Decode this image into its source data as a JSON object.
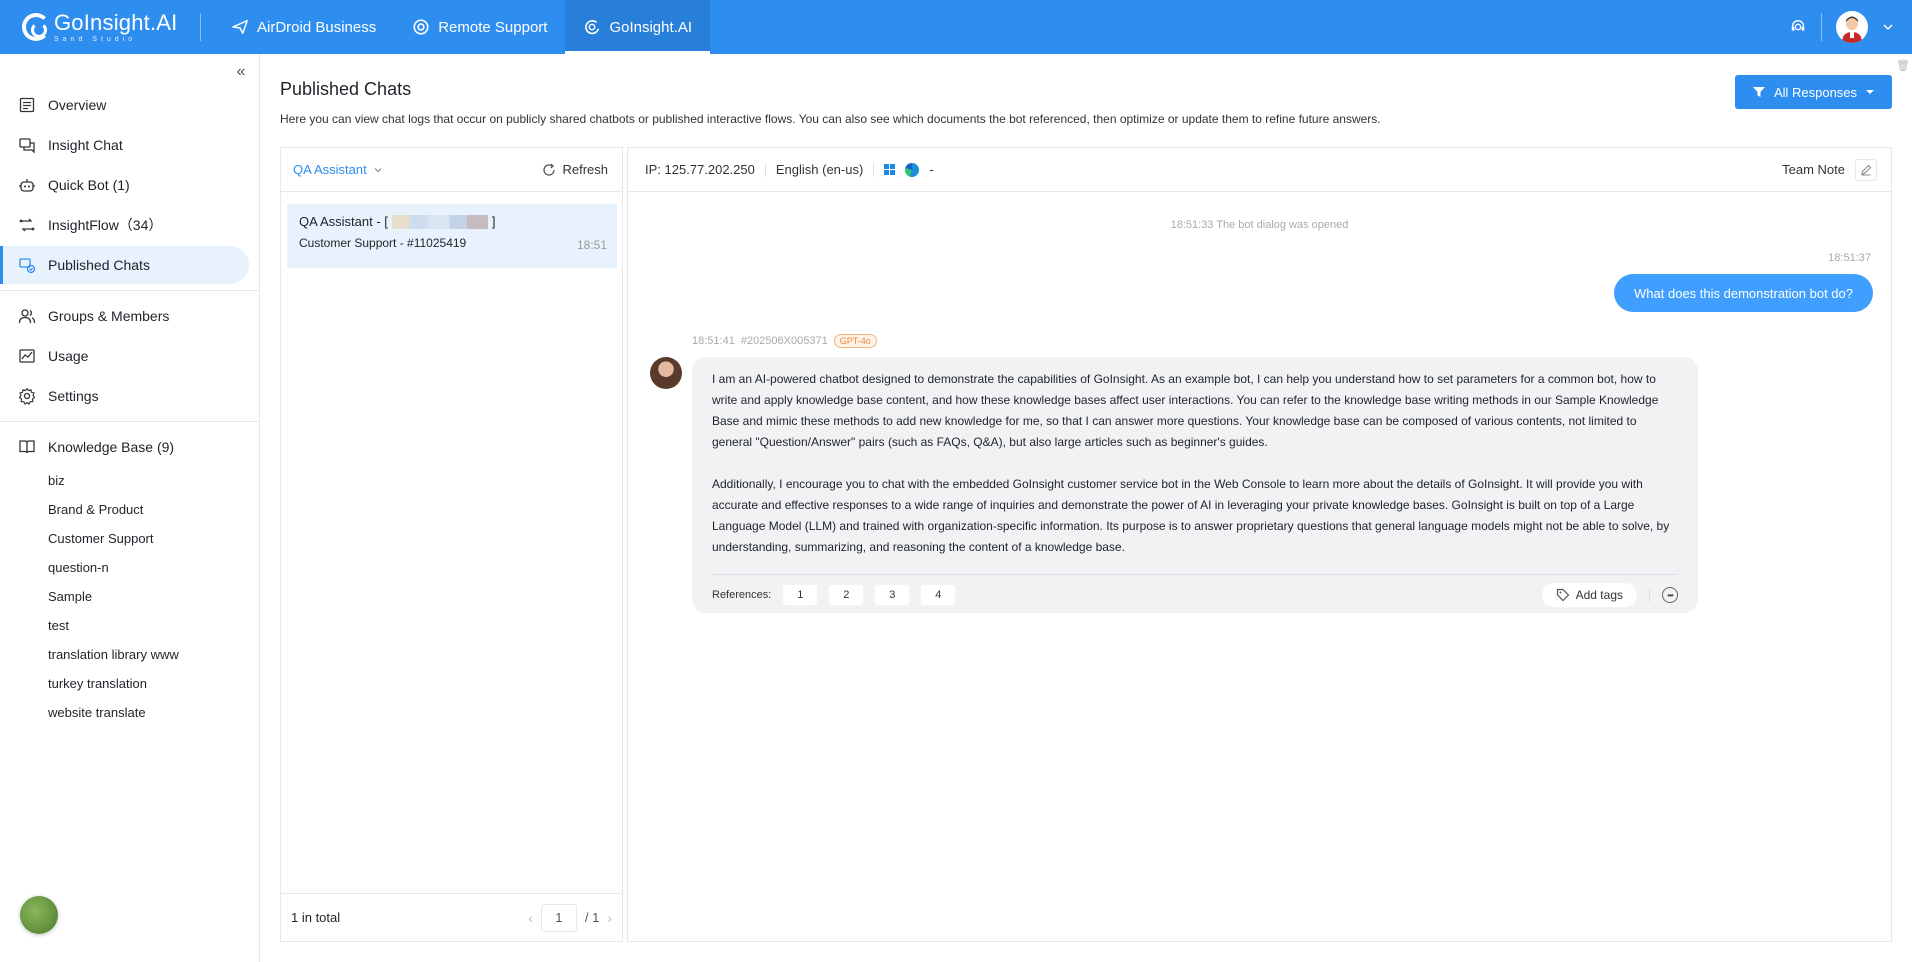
{
  "topbar": {
    "logo_title": "GoInsight.AI",
    "logo_sub": "Sand Studio",
    "nav": [
      {
        "label": "AirDroid Business"
      },
      {
        "label": "Remote Support"
      },
      {
        "label": "GoInsight.AI"
      }
    ],
    "active_nav": "GoInsight.AI"
  },
  "sidebar": {
    "items": [
      {
        "label": "Overview",
        "icon": "overview-icon"
      },
      {
        "label": "Insight Chat",
        "icon": "chat-icon"
      },
      {
        "label": "Quick Bot (1)",
        "icon": "bot-icon"
      },
      {
        "label": "InsightFlow（34）",
        "icon": "flow-icon"
      },
      {
        "label": "Published Chats",
        "icon": "published-icon"
      }
    ],
    "items2": [
      {
        "label": "Groups & Members",
        "icon": "users-icon"
      },
      {
        "label": "Usage",
        "icon": "usage-icon"
      },
      {
        "label": "Settings",
        "icon": "gear-icon"
      }
    ],
    "kb_header": "Knowledge Base (9)",
    "kb_items": [
      "biz",
      "Brand & Product",
      "Customer Support",
      "question-n",
      "Sample",
      "test",
      "translation library www",
      "turkey translation",
      "website translate"
    ]
  },
  "main": {
    "title": "Published Chats",
    "description": "Here you can view chat logs that occur on publicly shared chatbots or published interactive flows. You can also see which documents the bot referenced, then optimize or update them to refine future answers.",
    "filter_label": "All Responses"
  },
  "chat_list": {
    "assistant_label": "QA Assistant",
    "refresh_label": "Refresh",
    "item": {
      "title_prefix": "QA Assistant - [",
      "title_suffix": "]",
      "subtitle": "Customer Support - #11025419",
      "time": "18:51"
    },
    "total": "1 in total",
    "page_current": "1",
    "page_total": "/ 1"
  },
  "conversation": {
    "ip": "IP: 125.77.202.250",
    "language": "English (en-us)",
    "extra": "-",
    "team_note": "Team Note",
    "system_message": "18:51:33 The bot dialog was opened",
    "user_time": "18:51:37",
    "user_message": "What does this demonstration bot do?",
    "bot_time": "18:51:41",
    "bot_id": "#202506X005371",
    "model_badge": "GPT-4o",
    "bot_paragraph_1": "I am an AI-powered chatbot designed to demonstrate the capabilities of GoInsight. As an example bot, I can help you understand how to set parameters for a common bot, how to write and apply knowledge base content, and how these knowledge bases affect user interactions. You can refer to the knowledge base writing methods in our Sample Knowledge Base and mimic these methods to add new knowledge for me, so that I can answer more questions. Your knowledge base can be composed of various contents, not limited to general \"Question/Answer\" pairs (such as FAQs, Q&A), but also large articles such as beginner's guides.",
    "bot_paragraph_2": "Additionally, I encourage you to chat with the embedded GoInsight customer service bot in the Web Console to learn more about the details of GoInsight. It will provide you with accurate and effective responses to a wide range of inquiries and demonstrate the power of AI in leveraging your private knowledge bases. GoInsight is built on top of a Large Language Model (LLM) and trained with organization-specific information. Its purpose is to answer proprietary questions that general language models might not be able to solve, by understanding, summarizing, and reasoning the content of a knowledge base.",
    "references_label": "References:",
    "references": [
      "1",
      "2",
      "3",
      "4"
    ],
    "add_tags_label": "Add tags"
  },
  "colors": {
    "brand": "#2e8ef0",
    "user_bubble": "#409eff",
    "active_bg": "#e8f2fd",
    "badge_orange": "#e88a3c"
  }
}
